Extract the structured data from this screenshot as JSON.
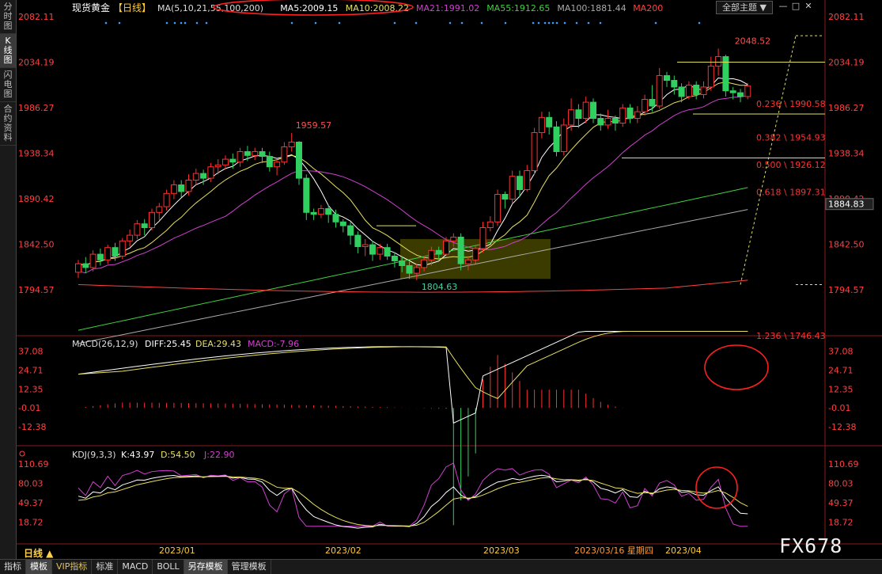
{
  "sidebar": [
    {
      "label": "分时图",
      "active": false
    },
    {
      "label": "K线图",
      "active": true
    },
    {
      "label": "闪电图",
      "active": false
    },
    {
      "label": "合约资料",
      "active": false
    }
  ],
  "header": {
    "instrument": "现货黄金",
    "period_tag": "【日线】",
    "items": [
      {
        "text": "MA(5,10,21,55,100,200)",
        "color": "#dddddd"
      },
      {
        "text": "MA5:2009.15",
        "color": "#ffffff"
      },
      {
        "text": "MA10:2008.22",
        "color": "#e8e060"
      },
      {
        "text": "MA21:1991.02",
        "color": "#d040d0"
      },
      {
        "text": "MA55:1912.65",
        "color": "#40d040"
      },
      {
        "text": "MA100:1881.44",
        "color": "#aaaaaa"
      },
      {
        "text": "MA200",
        "color": "#ff4040"
      }
    ],
    "theme_label": "全部主题 ▼",
    "window_buttons": [
      "—",
      "□",
      "✕"
    ]
  },
  "price_axis": {
    "labels": [
      "2082.11",
      "2034.19",
      "1986.27",
      "1938.34",
      "1890.42",
      "1842.50",
      "1794.57"
    ],
    "current": "1884.83"
  },
  "macd_panel": {
    "title": "MACD(26,12,9)",
    "diff": "DIFF:25.45",
    "dea": "DEA:29.43",
    "macd": "MACD:-7.96",
    "axis_labels": [
      "37.08",
      "24.71",
      "12.35",
      "-0.01",
      "-12.38"
    ]
  },
  "kdj_panel": {
    "title": "KDJ(9,3,3)",
    "k": "K:43.97",
    "d": "D:54.50",
    "j": "J:22.90",
    "axis_labels": [
      "110.69",
      "80.03",
      "49.37",
      "18.72"
    ]
  },
  "time_axis": {
    "labels": [
      "2023/01",
      "2023/02",
      "2023/03",
      "2023/03/16 星期四",
      "2023/04"
    ]
  },
  "annotations": {
    "high": "2048.52",
    "peak": "1959.57",
    "low": "1804.63",
    "fib": [
      {
        "text": "0.236 \\ 1990.58",
        "price": 1990.58
      },
      {
        "text": "0.382 \\ 1954.93",
        "price": 1954.93
      },
      {
        "text": "0.500 \\ 1926.12",
        "price": 1926.12
      },
      {
        "text": "0.618 \\ 1897.31",
        "price": 1897.31
      },
      {
        "text": "1.236 \\ 1746.43",
        "price": 1746.43
      }
    ]
  },
  "colors": {
    "up": "#ff3030",
    "down": "#30d060",
    "diff": "#ffffff",
    "dea": "#e8e060",
    "j": "#d040d0",
    "highlight": "#ff2020"
  },
  "period_label": "日线 ▲",
  "toolbar": [
    "指标",
    "模板",
    "VIP指标",
    "标准",
    "MACD",
    "BOLL",
    "另存模板",
    "管理模板"
  ],
  "watermark": "FX678",
  "chart_data": {
    "type": "candlestick",
    "title": "现货黄金 日线",
    "ylim": [
      1794.57,
      2082.11
    ],
    "candles": [
      [
        1813,
        1822,
        1807,
        1826
      ],
      [
        1822,
        1818,
        1812,
        1829
      ],
      [
        1818,
        1832,
        1814,
        1836
      ],
      [
        1832,
        1826,
        1820,
        1838
      ],
      [
        1826,
        1839,
        1822,
        1842
      ],
      [
        1839,
        1830,
        1825,
        1844
      ],
      [
        1830,
        1846,
        1827,
        1849
      ],
      [
        1846,
        1852,
        1840,
        1858
      ],
      [
        1852,
        1864,
        1848,
        1868
      ],
      [
        1864,
        1860,
        1852,
        1869
      ],
      [
        1860,
        1876,
        1857,
        1880
      ],
      [
        1876,
        1882,
        1868,
        1886
      ],
      [
        1882,
        1896,
        1878,
        1900
      ],
      [
        1896,
        1905,
        1890,
        1910
      ],
      [
        1905,
        1898,
        1892,
        1910
      ],
      [
        1898,
        1910,
        1894,
        1916
      ],
      [
        1910,
        1917,
        1905,
        1922
      ],
      [
        1917,
        1912,
        1905,
        1921
      ],
      [
        1912,
        1924,
        1908,
        1928
      ],
      [
        1924,
        1926,
        1916,
        1932
      ],
      [
        1926,
        1932,
        1921,
        1936
      ],
      [
        1932,
        1929,
        1922,
        1938
      ],
      [
        1929,
        1940,
        1924,
        1944
      ],
      [
        1940,
        1936,
        1930,
        1946
      ],
      [
        1936,
        1940,
        1931,
        1944
      ],
      [
        1940,
        1935,
        1928,
        1944
      ],
      [
        1935,
        1924,
        1919,
        1940
      ],
      [
        1924,
        1929,
        1915,
        1932
      ],
      [
        1929,
        1945,
        1926,
        1950
      ],
      [
        1945,
        1950,
        1940,
        1959.57
      ],
      [
        1950,
        1912,
        1905,
        1951
      ],
      [
        1912,
        1876,
        1868,
        1916
      ],
      [
        1876,
        1874,
        1868,
        1880
      ],
      [
        1874,
        1880,
        1870,
        1884
      ],
      [
        1880,
        1874,
        1865,
        1884
      ],
      [
        1874,
        1866,
        1860,
        1879
      ],
      [
        1866,
        1862,
        1855,
        1869
      ],
      [
        1862,
        1852,
        1842,
        1866
      ],
      [
        1852,
        1840,
        1833,
        1856
      ],
      [
        1840,
        1842,
        1830,
        1848
      ],
      [
        1842,
        1832,
        1825,
        1846
      ],
      [
        1832,
        1839,
        1826,
        1843
      ],
      [
        1839,
        1830,
        1826,
        1843
      ],
      [
        1830,
        1825,
        1818,
        1834
      ],
      [
        1825,
        1820,
        1813,
        1830
      ],
      [
        1820,
        1812,
        1806,
        1824
      ],
      [
        1812,
        1818,
        1804.63,
        1822
      ],
      [
        1818,
        1826,
        1814,
        1830
      ],
      [
        1826,
        1836,
        1820,
        1840
      ],
      [
        1836,
        1832,
        1826,
        1840
      ],
      [
        1832,
        1846,
        1830,
        1850
      ],
      [
        1846,
        1850,
        1840,
        1854
      ],
      [
        1850,
        1822,
        1815,
        1854
      ],
      [
        1822,
        1826,
        1815,
        1830
      ],
      [
        1826,
        1838,
        1822,
        1842
      ],
      [
        1838,
        1860,
        1834,
        1866
      ],
      [
        1860,
        1866,
        1856,
        1872
      ],
      [
        1866,
        1895,
        1862,
        1900
      ],
      [
        1895,
        1890,
        1880,
        1898
      ],
      [
        1890,
        1914,
        1885,
        1920
      ],
      [
        1914,
        1900,
        1892,
        1920
      ],
      [
        1900,
        1920,
        1898,
        1926
      ],
      [
        1920,
        1960,
        1916,
        1965
      ],
      [
        1960,
        1976,
        1954,
        1982
      ],
      [
        1976,
        1966,
        1958,
        1982
      ],
      [
        1966,
        1940,
        1935,
        1972
      ],
      [
        1940,
        1968,
        1936,
        1975
      ],
      [
        1968,
        1984,
        1962,
        1996
      ],
      [
        1984,
        1975,
        1965,
        1990
      ],
      [
        1975,
        1992,
        1970,
        1998
      ],
      [
        1992,
        1975,
        1970,
        1996
      ],
      [
        1975,
        1968,
        1962,
        1980
      ],
      [
        1968,
        1975,
        1964,
        1984
      ],
      [
        1975,
        1970,
        1962,
        1978
      ],
      [
        1970,
        1986,
        1966,
        1990
      ],
      [
        1986,
        1975,
        1970,
        1990
      ],
      [
        1975,
        1982,
        1970,
        1988
      ],
      [
        1982,
        1995,
        1978,
        2000
      ],
      [
        1995,
        1988,
        1982,
        2010
      ],
      [
        1988,
        2020,
        1985,
        2028
      ],
      [
        2020,
        2015,
        2008,
        2024
      ],
      [
        2015,
        2008,
        2000,
        2020
      ],
      [
        2008,
        1998,
        1992,
        2012
      ],
      [
        1998,
        2010,
        1995,
        2014
      ],
      [
        2010,
        2000,
        1995,
        2014
      ],
      [
        2000,
        2008,
        1996,
        2014
      ],
      [
        2008,
        2030,
        2004,
        2040
      ],
      [
        2030,
        2040,
        2020,
        2048.52
      ],
      [
        2040,
        2004,
        1998,
        2042
      ],
      [
        2004,
        2002,
        1995,
        2008
      ],
      [
        2002,
        1998,
        1992,
        2006
      ],
      [
        1998,
        2009,
        1995,
        2012
      ]
    ],
    "indicators": [
      "MA5",
      "MA10",
      "MA21",
      "MA55",
      "MA100",
      "MA200",
      "MACD(26,12,9)",
      "KDJ(9,3,3)"
    ]
  }
}
